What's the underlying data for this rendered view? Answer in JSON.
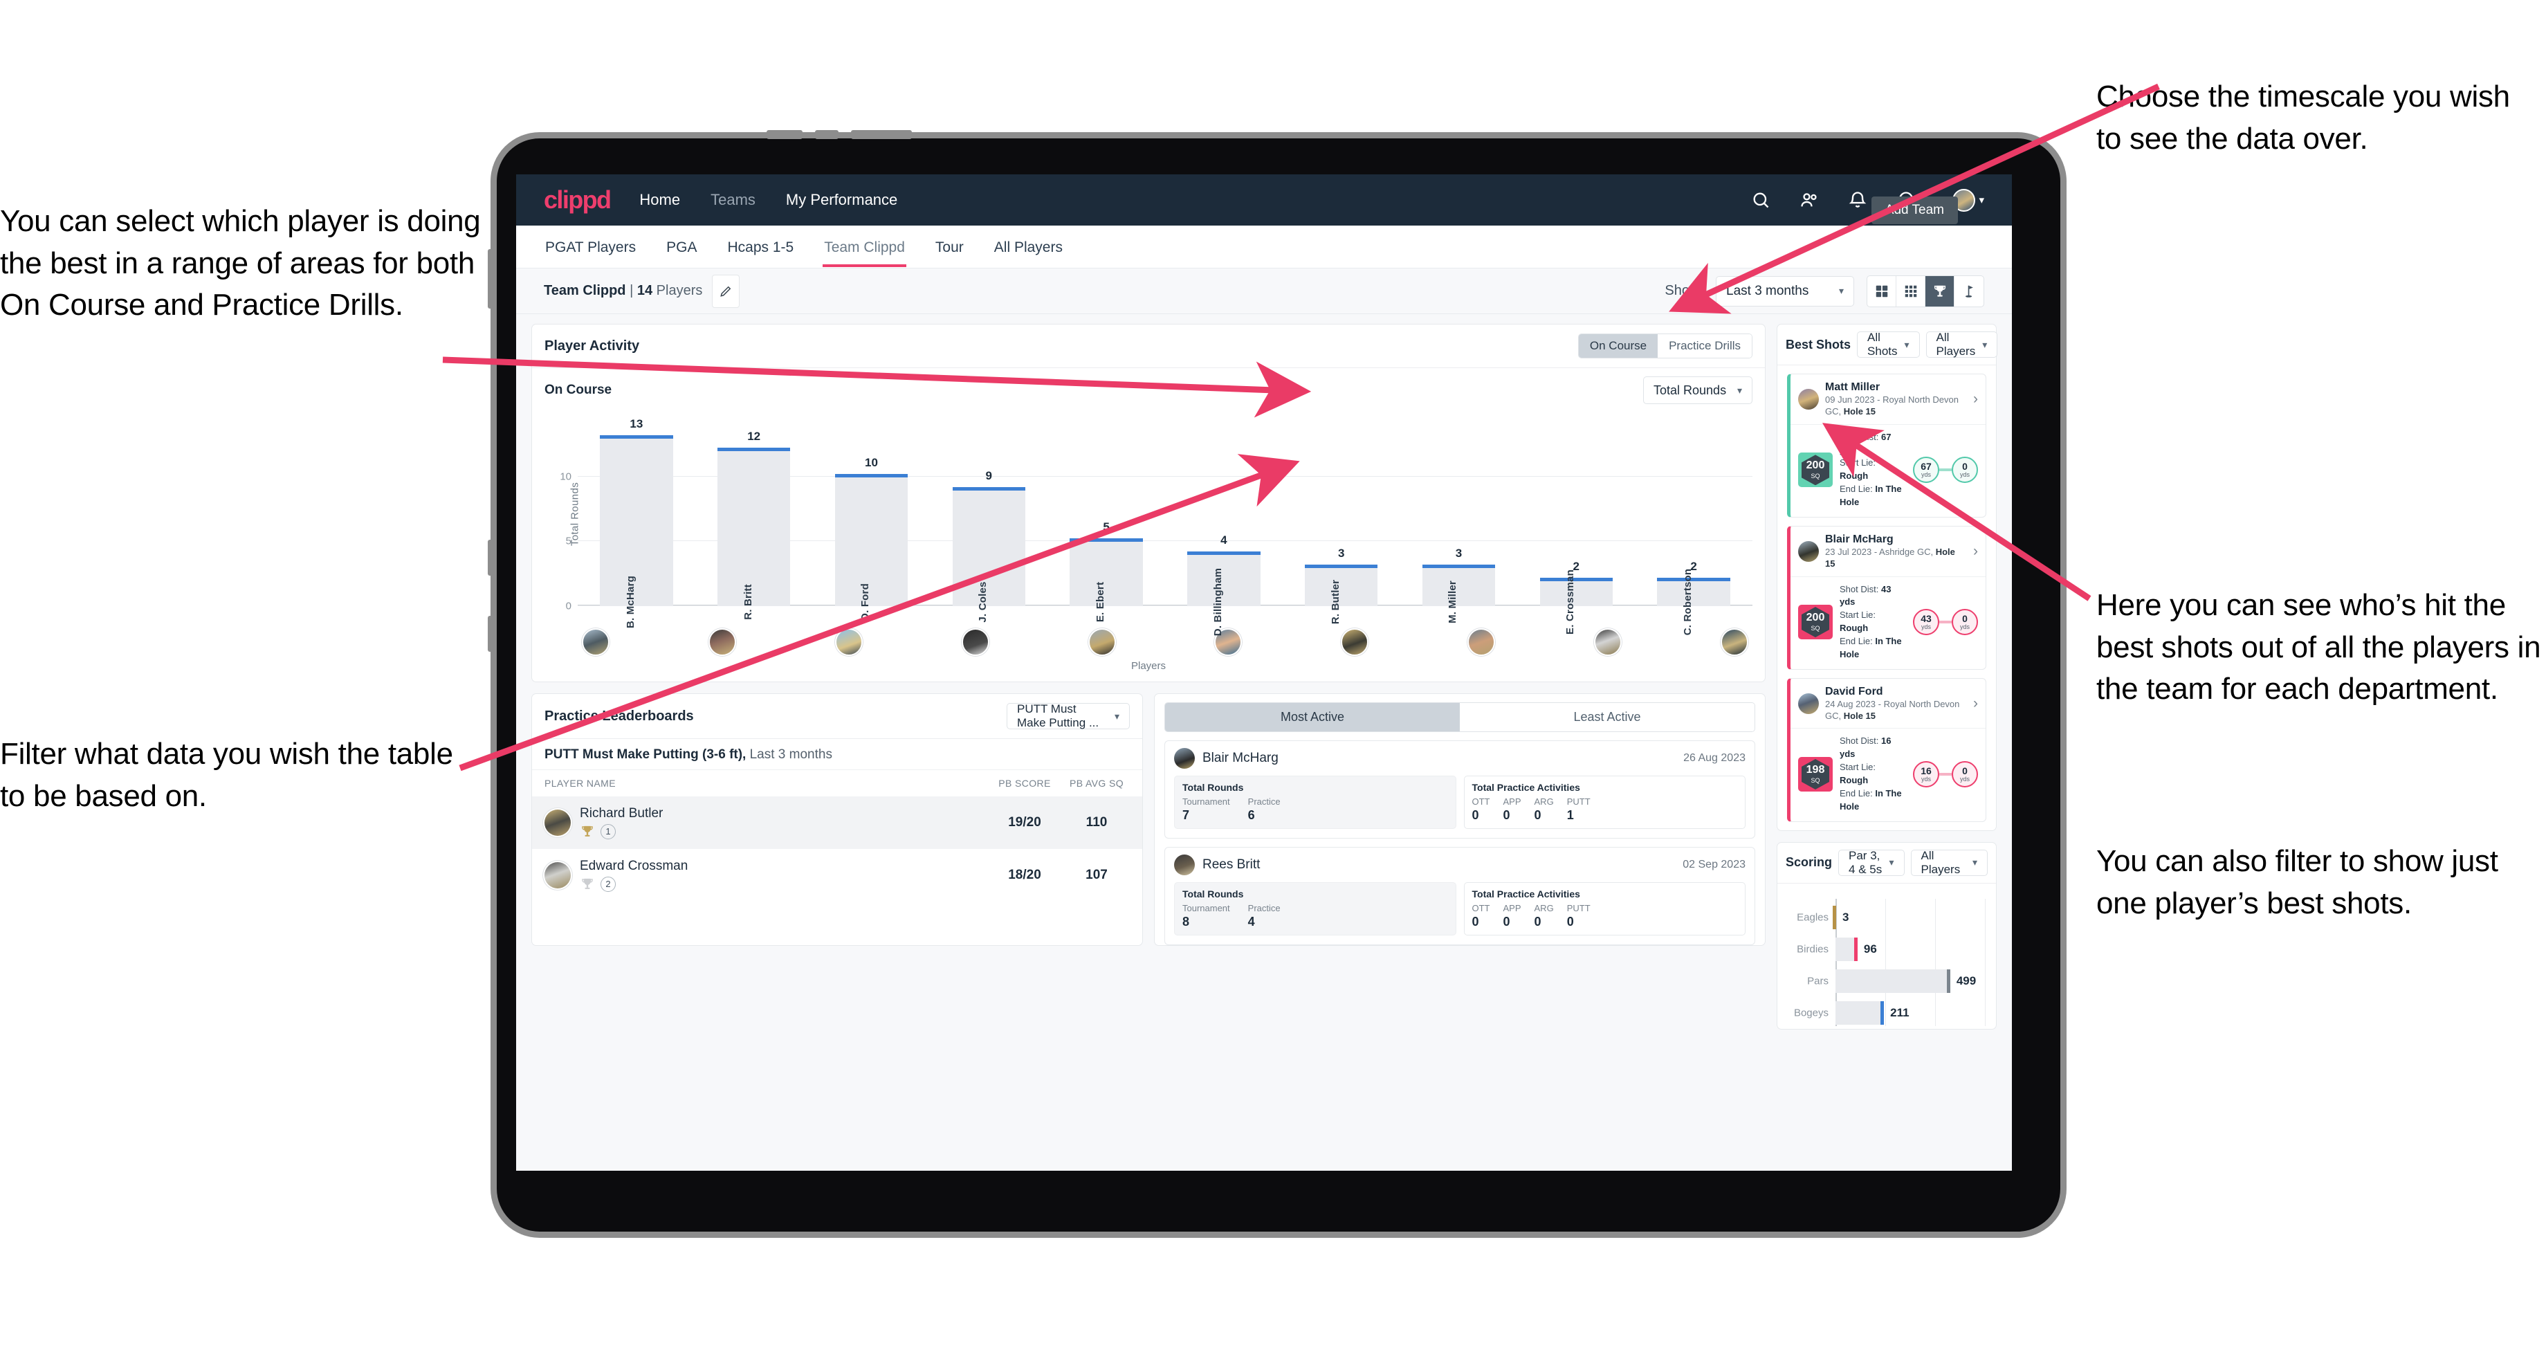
{
  "annotations": {
    "left_top": "You can select which player is doing the best in a range of areas for both On Course and Practice Drills.",
    "left_bottom": "Filter what data you wish the table to be based on.",
    "right_top": "Choose the timescale you wish to see the data over.",
    "right_middle": "Here you can see who’s hit the best shots out of all the players in the team for each department.",
    "right_bottom": "You can also filter to show just one player’s best shots."
  },
  "app": {
    "logo": "clippd",
    "nav": [
      {
        "label": "Home",
        "dim": false
      },
      {
        "label": "Teams",
        "dim": true
      },
      {
        "label": "My Performance",
        "dim": false
      }
    ],
    "nav_icons": [
      "search-icon",
      "people-icon",
      "bell-icon",
      "plus-circle-icon",
      "avatar"
    ],
    "tooltip": "Add Team",
    "tabs": [
      {
        "label": "PGAT Players",
        "active": false
      },
      {
        "label": "PGA",
        "active": false
      },
      {
        "label": "Hcaps 1-5",
        "active": false
      },
      {
        "label": "Team Clippd",
        "active": true
      },
      {
        "label": "Tour",
        "active": false
      },
      {
        "label": "All Players",
        "active": false
      }
    ],
    "subheader": {
      "team_name": "Team Clippd",
      "separator": "|",
      "player_count": "14",
      "players_word": "Players",
      "show_label": "Show:",
      "timescale": "Last 3 months",
      "view_buttons": [
        "grid-large-icon",
        "grid-small-icon",
        "trophy-icon",
        "flag-icon"
      ],
      "view_active_index": 2
    }
  },
  "player_activity": {
    "title": "Player Activity",
    "segments": [
      {
        "label": "On Course",
        "active": true
      },
      {
        "label": "Practice Drills",
        "active": false
      }
    ],
    "sub_label": "On Course",
    "metric_select": "Total Rounds"
  },
  "chart_data": {
    "type": "bar",
    "title": "Player Activity — On Course",
    "xlabel": "Players",
    "ylabel": "Total Rounds",
    "ylim": [
      0,
      14
    ],
    "yticks": [
      0,
      5,
      10
    ],
    "grid": true,
    "categories": [
      "B. McHarg",
      "R. Britt",
      "D. Ford",
      "J. Coles",
      "E. Ebert",
      "D. Billingham",
      "R. Butler",
      "M. Miller",
      "E. Crossman",
      "C. Robertson"
    ],
    "values": [
      13,
      12,
      10,
      9,
      5,
      4,
      3,
      3,
      2,
      2
    ],
    "bar_color": "#e8eaee",
    "cap_color": "#3b7fd4"
  },
  "best_shots": {
    "title": "Best Shots",
    "shot_filter": "All Shots",
    "player_filter": "All Players",
    "cards": [
      {
        "name": "Matt Miller",
        "meta_date": "09 Jun 2023 - Royal North Devon GC,",
        "meta_hole": "Hole 15",
        "badge_value": "200",
        "badge_unit": "SQ",
        "accent": "teal",
        "shot_dist_label": "Shot Dist:",
        "shot_dist": "67 yds",
        "start_lie_label": "Start Lie:",
        "start_lie": "Rough",
        "end_lie_label": "End Lie:",
        "end_lie": "In The Hole",
        "from_value": "67",
        "from_unit": "yds",
        "to_value": "0",
        "to_unit": "yds"
      },
      {
        "name": "Blair McHarg",
        "meta_date": "23 Jul 2023 - Ashridge GC,",
        "meta_hole": "Hole 15",
        "badge_value": "200",
        "badge_unit": "SQ",
        "accent": "pink",
        "shot_dist_label": "Shot Dist:",
        "shot_dist": "43 yds",
        "start_lie_label": "Start Lie:",
        "start_lie": "Rough",
        "end_lie_label": "End Lie:",
        "end_lie": "In The Hole",
        "from_value": "43",
        "from_unit": "yds",
        "to_value": "0",
        "to_unit": "yds"
      },
      {
        "name": "David Ford",
        "meta_date": "24 Aug 2023 - Royal North Devon GC,",
        "meta_hole": "Hole 15",
        "badge_value": "198",
        "badge_unit": "SQ",
        "accent": "pink",
        "shot_dist_label": "Shot Dist:",
        "shot_dist": "16 yds",
        "start_lie_label": "Start Lie:",
        "start_lie": "Rough",
        "end_lie_label": "End Lie:",
        "end_lie": "In The Hole",
        "from_value": "16",
        "from_unit": "yds",
        "to_value": "0",
        "to_unit": "yds"
      }
    ]
  },
  "practice_leaderboards": {
    "title": "Practice Leaderboards",
    "drill_select": "PUTT Must Make Putting ...",
    "subtitle_bold": "PUTT Must Make Putting (3-6 ft),",
    "subtitle_rest": "Last 3 months",
    "columns": [
      "PLAYER NAME",
      "PB SCORE",
      "PB AVG SQ"
    ],
    "rows": [
      {
        "name": "Richard Butler",
        "rank": "1",
        "trophy": "gold",
        "pb_score": "19/20",
        "pb_avg_sq": "110"
      },
      {
        "name": "Edward Crossman",
        "rank": "2",
        "trophy": "silver",
        "pb_score": "18/20",
        "pb_avg_sq": "107"
      }
    ]
  },
  "activity": {
    "tabs": [
      {
        "label": "Most Active",
        "active": true
      },
      {
        "label": "Least Active",
        "active": false
      }
    ],
    "rounds_title": "Total Rounds",
    "practice_title": "Total Practice Activities",
    "rounds_keys": [
      "Tournament",
      "Practice"
    ],
    "practice_keys": [
      "OTT",
      "APP",
      "ARG",
      "PUTT"
    ],
    "cards": [
      {
        "name": "Blair McHarg",
        "date": "26 Aug 2023",
        "rounds_values": [
          "7",
          "6"
        ],
        "practice_values": [
          "0",
          "0",
          "0",
          "1"
        ]
      },
      {
        "name": "Rees Britt",
        "date": "02 Sep 2023",
        "rounds_values": [
          "8",
          "4"
        ],
        "practice_values": [
          "0",
          "0",
          "0",
          "0"
        ]
      }
    ]
  },
  "scoring": {
    "title": "Scoring",
    "par_filter": "Par 3, 4 & 5s",
    "player_filter": "All Players",
    "chart": {
      "type": "bar",
      "orientation": "horizontal",
      "categories": [
        "Eagles",
        "Birdies",
        "Pars",
        "Bogeys"
      ],
      "values": [
        3,
        96,
        499,
        211
      ],
      "xlim": [
        0,
        650
      ],
      "cap_colors": [
        "#b79246",
        "#ee3e6d",
        "#7b858e",
        "#3b7fd4"
      ],
      "bar_color": "#e8eaee"
    }
  }
}
